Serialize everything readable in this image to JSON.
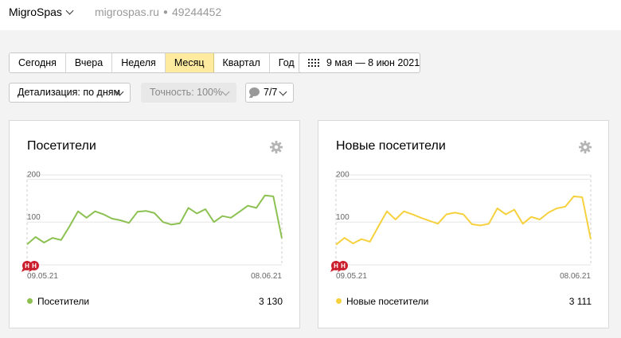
{
  "header": {
    "counter_name": "MigroSpas",
    "site": "migrospas.ru",
    "counter_id": "49244452"
  },
  "periods": [
    "Сегодня",
    "Вчера",
    "Неделя",
    "Месяц",
    "Квартал",
    "Год"
  ],
  "active_period": "Месяц",
  "date_range": "9 мая — 8 июн 2021",
  "detail_dropdown": "Детализация: по дням",
  "accuracy_dropdown": "Точность: 100%",
  "comments_dropdown": "7/7",
  "colors": {
    "visitors_line": "#8cc152",
    "new_visitors_line": "#f6d13d",
    "active_period_bg": "#ffeba0",
    "marker": "#cc1f2e"
  },
  "widgets": [
    {
      "title": "Посетители",
      "legend_label": "Посетители",
      "total": "3 130",
      "color": "#8cc152",
      "markers": [
        "Н",
        "Н"
      ]
    },
    {
      "title": "Новые посетители",
      "legend_label": "Новые посетители",
      "total": "3 111",
      "color": "#f6d13d",
      "markers": [
        "Н",
        "Н"
      ]
    }
  ],
  "chart_data": [
    {
      "type": "line",
      "x_start_label": "09.05.21",
      "x_end_label": "08.06.21",
      "yticks": [
        100,
        200
      ],
      "ylim": [
        0,
        210
      ],
      "grid": true,
      "series": [
        {
          "name": "Посетители",
          "values": [
            48,
            65,
            52,
            63,
            58,
            90,
            125,
            110,
            125,
            118,
            108,
            104,
            98,
            124,
            126,
            121,
            100,
            94,
            97,
            133,
            120,
            130,
            100,
            114,
            110,
            124,
            138,
            133,
            162,
            160,
            62
          ]
        }
      ]
    },
    {
      "type": "line",
      "x_start_label": "09.05.21",
      "x_end_label": "08.06.21",
      "yticks": [
        100,
        200
      ],
      "ylim": [
        0,
        210
      ],
      "grid": true,
      "series": [
        {
          "name": "Новые посетители",
          "values": [
            47,
            63,
            50,
            60,
            54,
            90,
            125,
            106,
            125,
            118,
            110,
            103,
            96,
            118,
            122,
            118,
            95,
            92,
            96,
            132,
            118,
            129,
            96,
            112,
            106,
            122,
            132,
            136,
            160,
            158,
            60
          ]
        }
      ]
    }
  ]
}
